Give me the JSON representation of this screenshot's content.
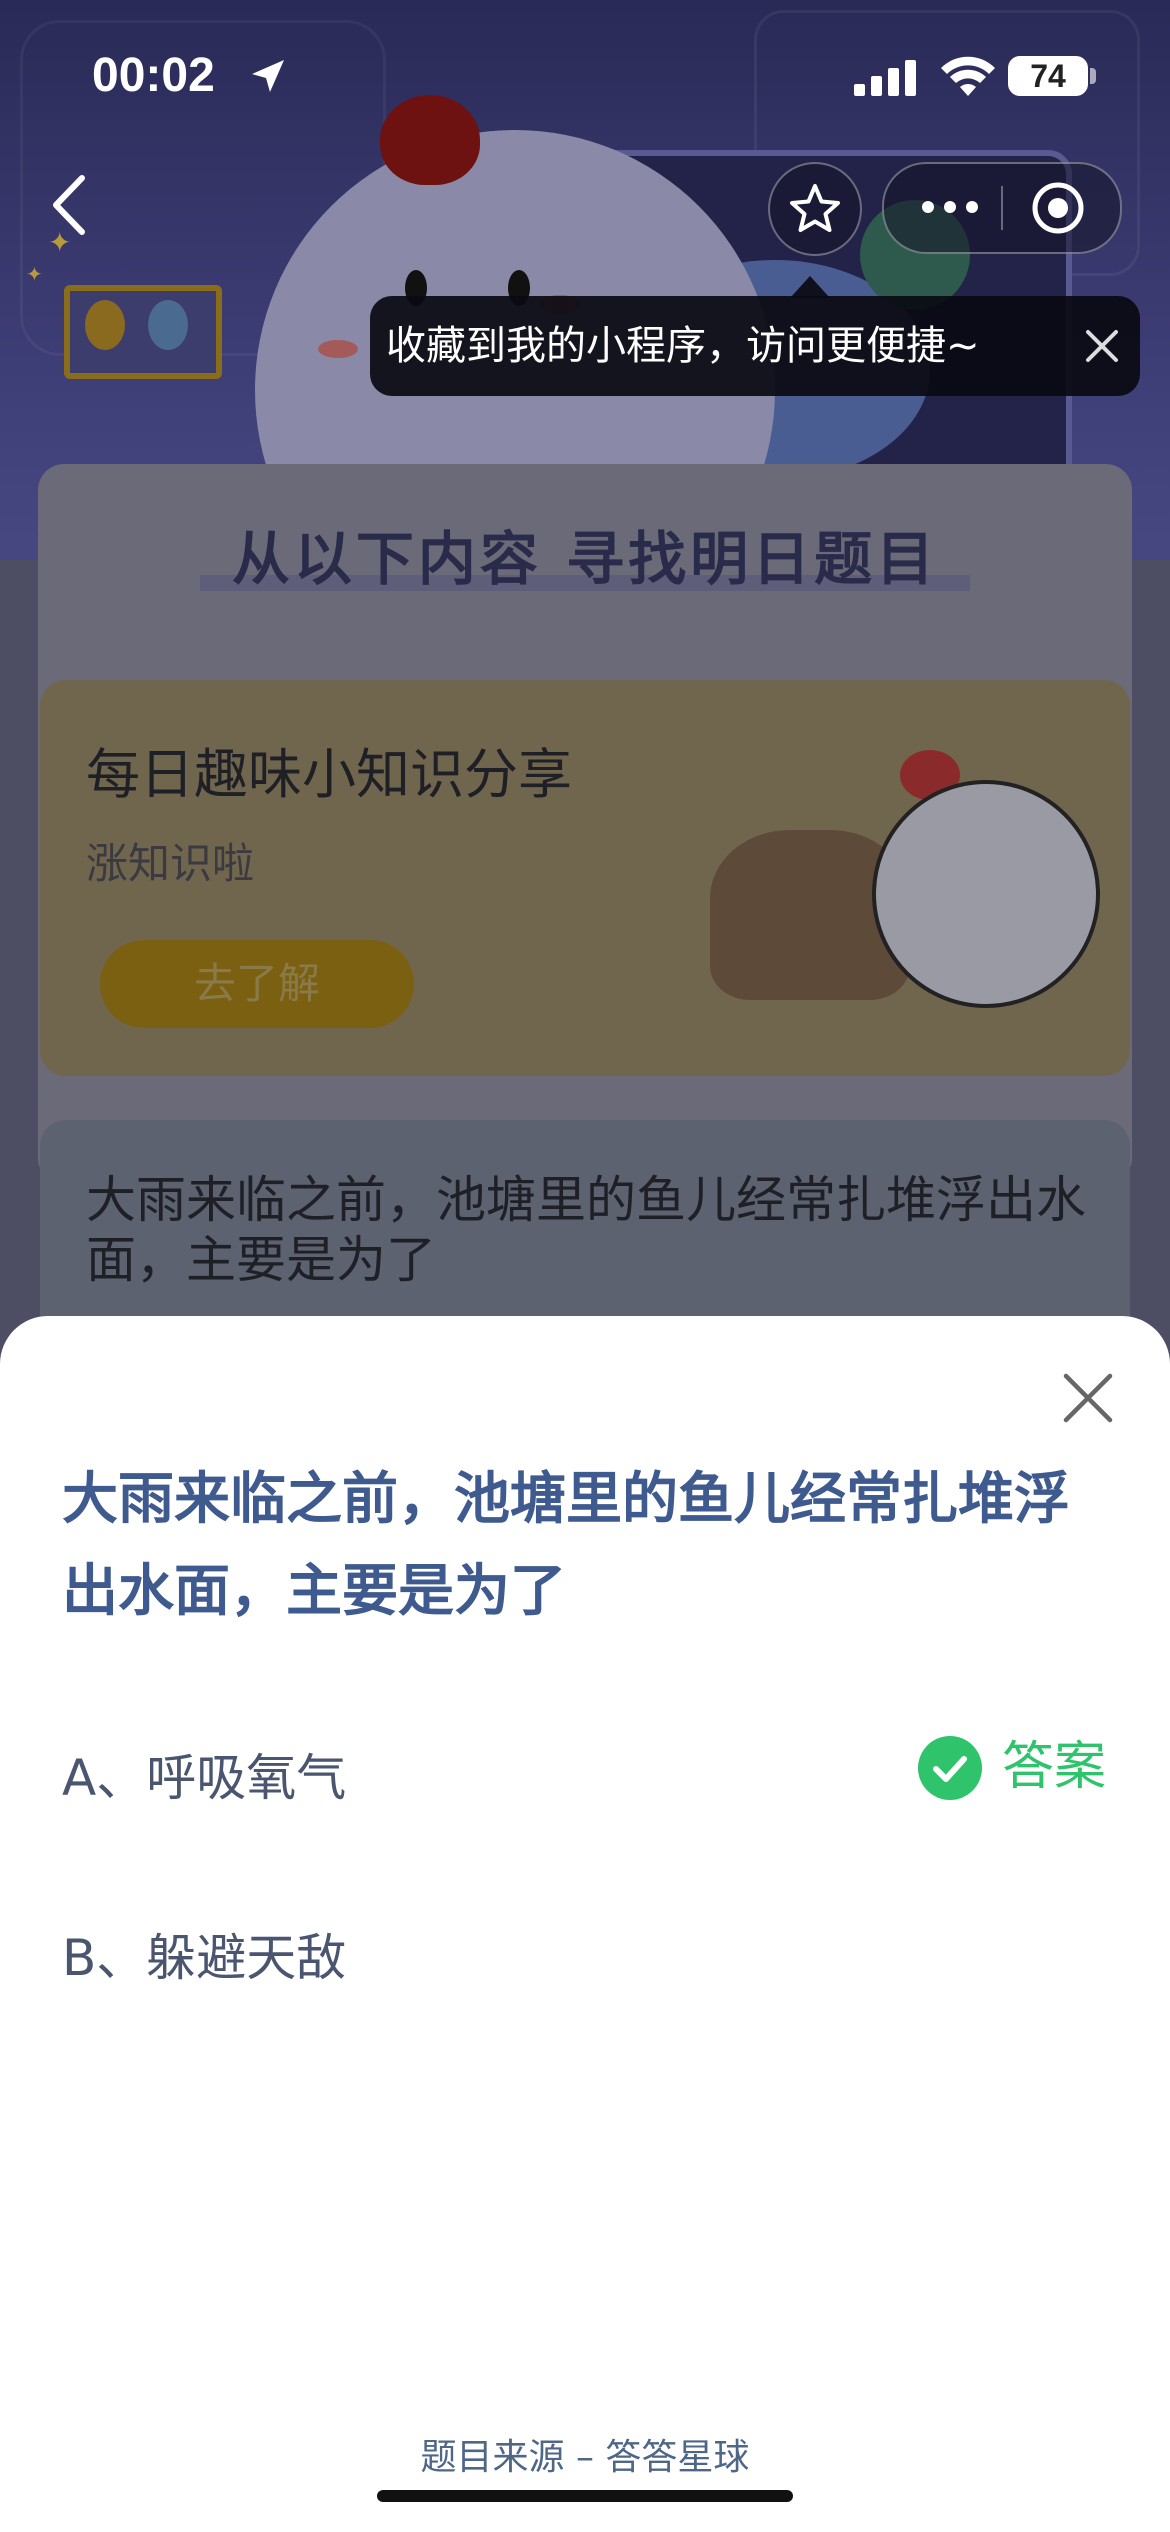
{
  "status_bar": {
    "time": "00:02",
    "battery": "74"
  },
  "nav": {
    "back_icon": "chevron-left-icon",
    "star_icon": "star-icon",
    "more_icon": "more-dots-icon",
    "close_icon": "target-circle-icon"
  },
  "tooltip": {
    "text": "收藏到我的小程序，访问更便捷~",
    "close_icon": "close-icon"
  },
  "background": {
    "panel_title": "从以下内容  寻找明日题目",
    "info_card": {
      "title": "每日趣味小知识分享",
      "subtitle": "涨知识啦",
      "button": "去了解"
    },
    "question_card": {
      "text": "大雨来临之前，池塘里的鱼儿经常扎堆浮出水面，主要是为了"
    }
  },
  "sheet": {
    "question": "大雨来临之前，池塘里的鱼儿经常扎堆浮出水面，主要是为了",
    "options": [
      {
        "label": "A、呼吸氧气",
        "is_answer": true
      },
      {
        "label": "B、躲避天敌",
        "is_answer": false
      }
    ],
    "answer_label": "答案",
    "source": "题目来源 – 答答星球",
    "close_icon": "close-icon"
  },
  "colors": {
    "accent_green": "#2fc36b",
    "question_blue": "#3e5a8e"
  }
}
